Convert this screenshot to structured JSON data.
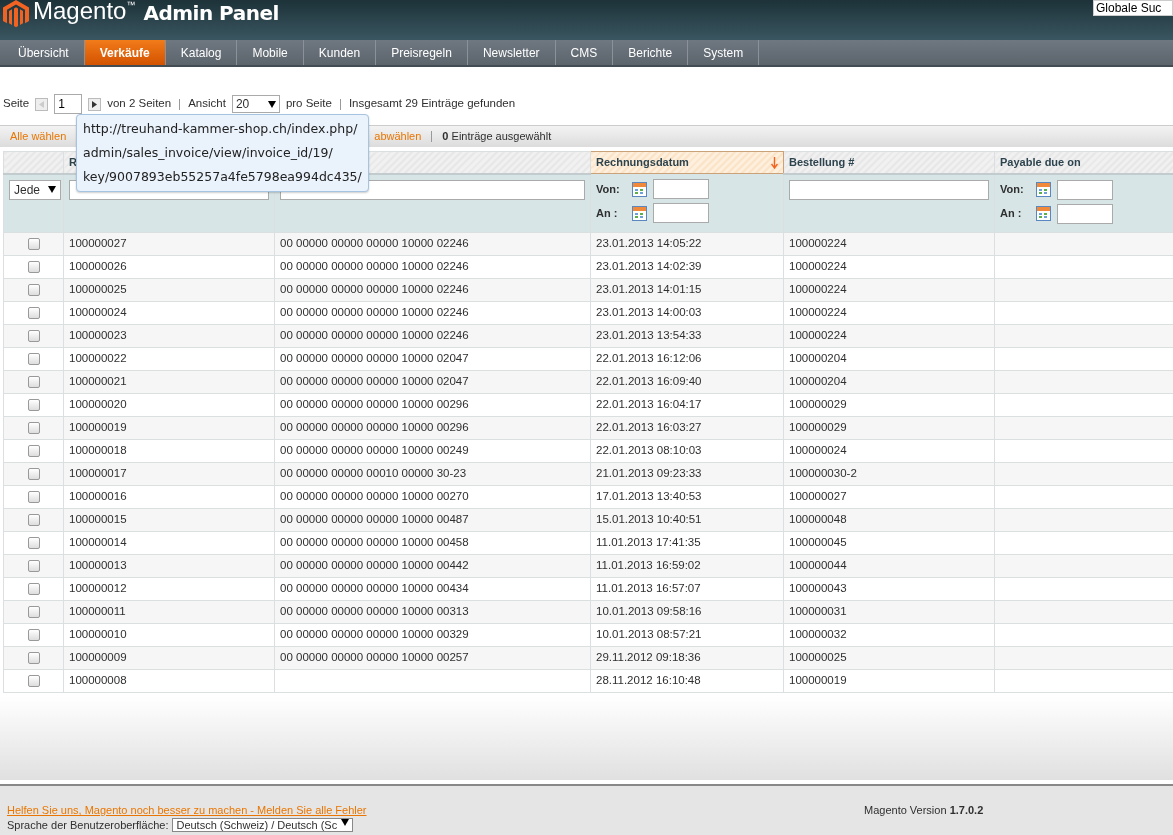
{
  "header": {
    "logo": "Magento$^{™}$",
    "title": "Admin Panel",
    "global_search": {
      "value": "Globale Suc"
    }
  },
  "nav": [
    {
      "label": "Übersicht",
      "selected": false
    },
    {
      "label": "Verkäufe",
      "selected": true
    },
    {
      "label": "Katalog",
      "selected": false
    },
    {
      "label": "Mobile",
      "selected": false
    },
    {
      "label": "Kunden",
      "selected": false
    },
    {
      "label": "Preisregeln",
      "selected": false
    },
    {
      "label": "Newsletter",
      "selected": false
    },
    {
      "label": "CMS",
      "selected": false
    },
    {
      "label": "Berichte",
      "selected": false
    },
    {
      "label": "System",
      "selected": false
    }
  ],
  "pager": {
    "page_label": "Seite",
    "page": "1",
    "of_pages": "von 2 Seiten",
    "view_label": "Ansicht",
    "per_page": "20",
    "per_page_label": "pro Seite",
    "total": "Insgesamt 29 Einträge gefunden"
  },
  "mass_action": {
    "links": [
      "Alle wählen",
      "abwählen"
    ],
    "selected_count": "**0** Einträge ausgewählt"
  },
  "tooltip": {
    "lines": [
      "http://treuhand-kammer-shop.ch/index.php/",
      "admin/sales_invoice/view/invoice_id/19/",
      "key/9007893eb55257a4fe5798ea994dc435/"
    ]
  },
  "table": {
    "columns": [
      {
        "sorted": false,
        "filter": {
          "kind": "select",
          "value": "Jede"
        }
      },
      {
        "label": "R",
        "sorted": false,
        "filter": {
          "kind": "text"
        }
      },
      {
        "sorted": false,
        "filter": {
          "kind": "text"
        }
      },
      {
        "label": "Rechnungsdatum",
        "sorted": true,
        "filter": {
          "kind": "date_range",
          "from_label": "Von:",
          "to_label": "An :"
        }
      },
      {
        "label": "Bestellung #",
        "sorted": false,
        "filter": {
          "kind": "text"
        }
      },
      {
        "label": "Payable due on",
        "sorted": false,
        "filter": {
          "kind": "date_range",
          "from_label": "Von:",
          "to_label": "An :"
        }
      }
    ],
    "rows": [
      {
        "checked": false,
        "id": "100000027",
        "column_3": "00 00000 00000 00000 10000 02246",
        "date": "23.01.2013 14:05:22",
        "order": "100000224"
      },
      {
        "checked": false,
        "id": "100000026",
        "column_3": "00 00000 00000 00000 10000 02246",
        "date": "23.01.2013 14:02:39",
        "order": "100000224"
      },
      {
        "checked": false,
        "id": "100000025",
        "column_3": "00 00000 00000 00000 10000 02246",
        "date": "23.01.2013 14:01:15",
        "order": "100000224"
      },
      {
        "checked": false,
        "id": "100000024",
        "column_3": "00 00000 00000 00000 10000 02246",
        "date": "23.01.2013 14:00:03",
        "order": "100000224"
      },
      {
        "checked": false,
        "id": "100000023",
        "column_3": "00 00000 00000 00000 10000 02246",
        "date": "23.01.2013 13:54:33",
        "order": "100000224"
      },
      {
        "checked": false,
        "id": "100000022",
        "column_3": "00 00000 00000 00000 10000 02047",
        "date": "22.01.2013 16:12:06",
        "order": "100000204"
      },
      {
        "checked": false,
        "id": "100000021",
        "column_3": "00 00000 00000 00000 10000 02047",
        "date": "22.01.2013 16:09:40",
        "order": "100000204"
      },
      {
        "checked": false,
        "id": "100000020",
        "column_3": "00 00000 00000 00000 10000 00296",
        "date": "22.01.2013 16:04:17",
        "order": "100000029"
      },
      {
        "checked": false,
        "id": "100000019",
        "column_3": "00 00000 00000 00000 10000 00296",
        "date": "22.01.2013 16:03:27",
        "order": "100000029"
      },
      {
        "checked": false,
        "id": "100000018",
        "column_3": "00 00000 00000 00000 10000 00249",
        "date": "22.01.2013 08:10:03",
        "order": "100000024"
      },
      {
        "checked": false,
        "id": "100000017",
        "column_3": "00 00000 00000 00010 00000 30-23",
        "date": "21.01.2013 09:23:33",
        "order": "100000030-2"
      },
      {
        "checked": false,
        "id": "100000016",
        "column_3": "00 00000 00000 00000 10000 00270",
        "date": "17.01.2013 13:40:53",
        "order": "100000027"
      },
      {
        "checked": false,
        "id": "100000015",
        "column_3": "00 00000 00000 00000 10000 00487",
        "date": "15.01.2013 10:40:51",
        "order": "100000048"
      },
      {
        "checked": false,
        "id": "100000014",
        "column_3": "00 00000 00000 00000 10000 00458",
        "date": "11.01.2013 17:41:35",
        "order": "100000045"
      },
      {
        "checked": false,
        "id": "100000013",
        "column_3": "00 00000 00000 00000 10000 00442",
        "date": "11.01.2013 16:59:02",
        "order": "100000044"
      },
      {
        "checked": false,
        "id": "100000012",
        "column_3": "00 00000 00000 00000 10000 00434",
        "date": "11.01.2013 16:57:07",
        "order": "100000043"
      },
      {
        "checked": false,
        "id": "100000011",
        "column_3": "00 00000 00000 00000 10000 00313",
        "date": "10.01.2013 09:58:16",
        "order": "100000031"
      },
      {
        "checked": false,
        "id": "100000010",
        "column_3": "00 00000 00000 00000 10000 00329",
        "date": "10.01.2013 08:57:21",
        "order": "100000032"
      },
      {
        "checked": false,
        "id": "100000009",
        "column_3": "00 00000 00000 00000 10000 00257",
        "date": "29.11.2012 09:18:36",
        "order": "100000025"
      },
      {
        "checked": false,
        "id": "100000008",
        "date": "28.11.2012 16:10:48",
        "order": "100000019"
      }
    ]
  },
  "footer": {
    "help_link": "Helfen Sie uns, Magento noch besser zu machen - Melden Sie alle Fehler",
    "version": "Magento Version **1.7.0.2**",
    "language_label": "Sprache der Benutzeroberfläche:",
    "language": "Deutsch (Schweiz) / Deutsch (Sc"
  }
}
